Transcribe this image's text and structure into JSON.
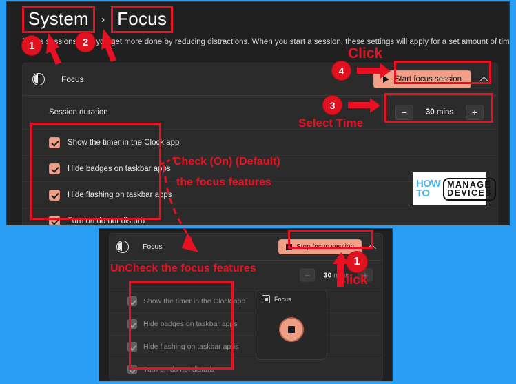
{
  "theme": {
    "page_background": "#2a9df4",
    "window_background": "#202020",
    "card_background": "#2b2b2b",
    "accent_button": "#f0a089",
    "annotation_red": "#e81123",
    "text_primary": "#efefef",
    "text_secondary": "#8f8f8f"
  },
  "top_window": {
    "breadcrumb": {
      "root": "System",
      "separator": "›",
      "current": "Focus"
    },
    "description": "Focus sessions help you get more done by reducing distractions. When you start a session, these settings will apply for a set amount of time.",
    "focus_card": {
      "icon": "moon-icon",
      "title": "Focus",
      "session_button": {
        "label": "Start focus session",
        "icon": "play-icon",
        "state": "idle"
      },
      "collapse_icon": "chevron-up-icon",
      "duration": {
        "label": "Session duration",
        "decrement": "−",
        "value": "30",
        "unit": "mins",
        "increment": "+"
      },
      "checkboxes": [
        {
          "label": "Show the timer in the Clock app",
          "checked": true,
          "enabled": true
        },
        {
          "label": "Hide badges on taskbar apps",
          "checked": true,
          "enabled": true
        },
        {
          "label": "Hide flashing on taskbar apps",
          "checked": true,
          "enabled": true
        },
        {
          "label": "Turn on do not disturb",
          "checked": true,
          "enabled": true
        }
      ]
    }
  },
  "bottom_window": {
    "focus_card": {
      "icon": "moon-icon",
      "title": "Focus",
      "session_button": {
        "label": "Stop focus session",
        "icon": "stop-square-icon",
        "state": "running"
      },
      "collapse_icon": "chevron-up-icon",
      "duration": {
        "decrement": "−",
        "value": "30",
        "unit": "mins",
        "increment": "+"
      },
      "checkboxes": [
        {
          "label": "Show the timer in the Clock app",
          "checked": true,
          "enabled": false
        },
        {
          "label": "Hide badges on taskbar apps",
          "checked": true,
          "enabled": false
        },
        {
          "label": "Hide flashing on taskbar apps",
          "checked": true,
          "enabled": false
        },
        {
          "label": "Turn on do not disturb",
          "checked": true,
          "enabled": false
        }
      ]
    },
    "focus_widget": {
      "icon": "focus-widget-icon",
      "title": "Focus",
      "stop_button_icon": "stop-circle-icon"
    }
  },
  "annotations": {
    "badge_1_top": "1",
    "badge_2_top": "2",
    "badge_3_top": "3",
    "badge_4_top": "4",
    "badge_1_bottom": "1",
    "click_top": "Click",
    "select_time": "Select Time",
    "check_line1": "Check (On) (Default)",
    "check_line2": "the focus features",
    "uncheck_text": "UnCheck the focus features",
    "click_bottom": "Click"
  },
  "watermark": {
    "line1": "HOW",
    "line2": "TO",
    "line3": "MANAGE",
    "line4": "DEVICES"
  }
}
